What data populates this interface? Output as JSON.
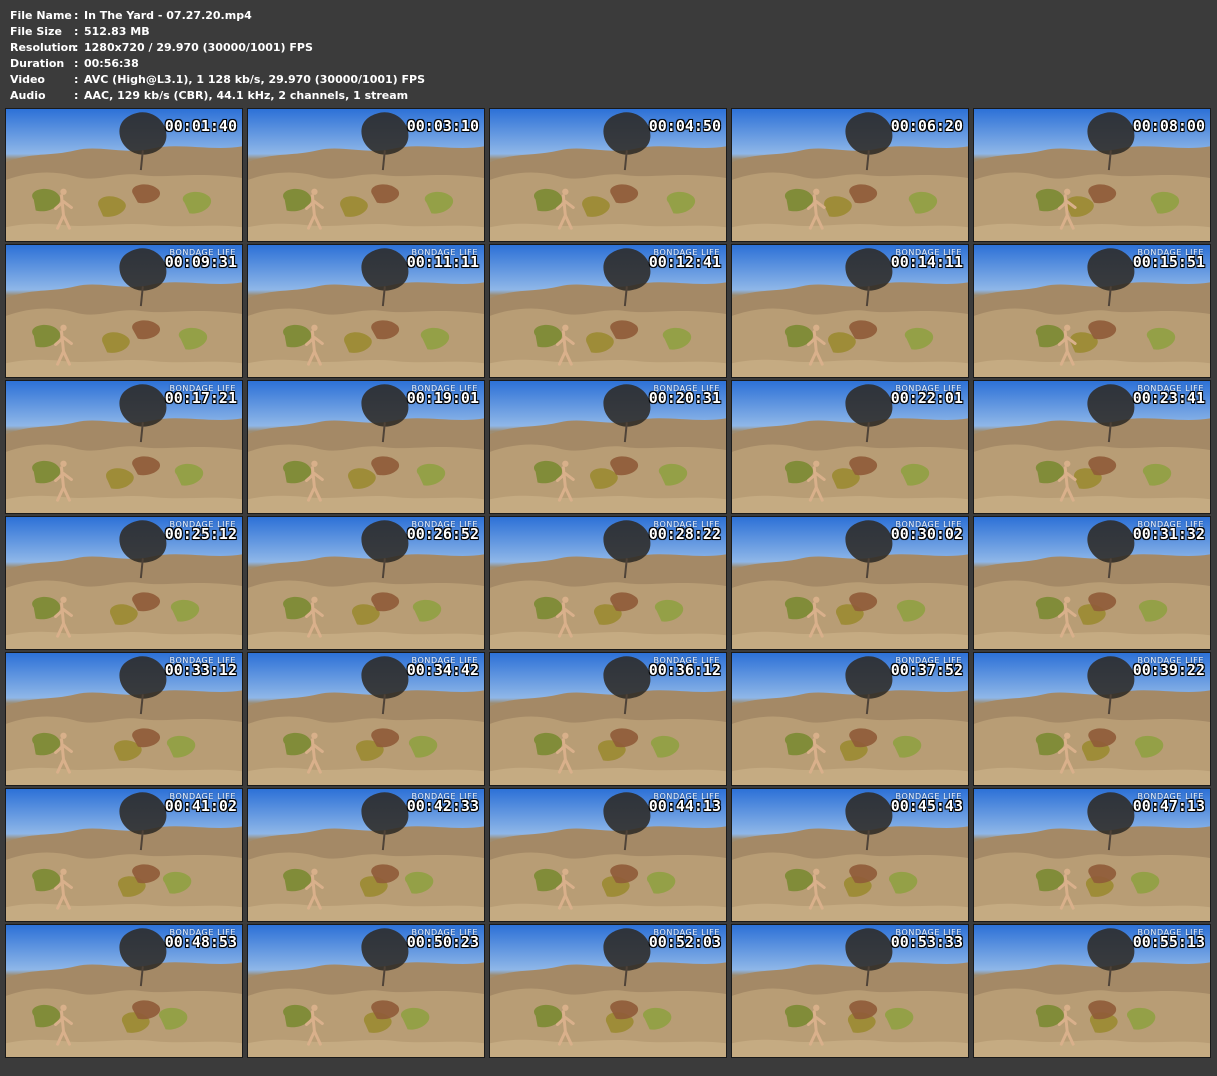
{
  "metadata": {
    "fields": [
      {
        "label": "File Name",
        "separator": ":",
        "value": "In The Yard - 07.27.20.mp4"
      },
      {
        "label": "File Size",
        "separator": ":",
        "value": "512.83 MB"
      },
      {
        "label": "Resolution",
        "separator": ":",
        "value": "1280x720 / 29.970 (30000/1001) FPS"
      },
      {
        "label": "Duration",
        "separator": ":",
        "value": "00:56:38"
      },
      {
        "label": "Video",
        "separator": ":",
        "value": "AVC (High@L3.1), 1 128 kb/s, 29.970 (30000/1001) FPS"
      },
      {
        "label": "Audio",
        "separator": ":",
        "value": "AAC, 129 kb/s (CBR), 44.1 kHz, 2 channels, 1 stream"
      }
    ]
  },
  "thumbnails": [
    {
      "time": "00:01:40",
      "watermark": ""
    },
    {
      "time": "00:03:10",
      "watermark": ""
    },
    {
      "time": "00:04:50",
      "watermark": ""
    },
    {
      "time": "00:06:20",
      "watermark": ""
    },
    {
      "time": "00:08:00",
      "watermark": ""
    },
    {
      "time": "00:09:31",
      "watermark": "BONDAGE LIFE"
    },
    {
      "time": "00:11:11",
      "watermark": "BONDAGE LIFE"
    },
    {
      "time": "00:12:41",
      "watermark": "BONDAGE LIFE"
    },
    {
      "time": "00:14:11",
      "watermark": "BONDAGE LIFE"
    },
    {
      "time": "00:15:51",
      "watermark": "BONDAGE LIFE"
    },
    {
      "time": "00:17:21",
      "watermark": "BONDAGE LIFE"
    },
    {
      "time": "00:19:01",
      "watermark": "BONDAGE LIFE"
    },
    {
      "time": "00:20:31",
      "watermark": "BONDAGE LIFE"
    },
    {
      "time": "00:22:01",
      "watermark": "BONDAGE LIFE"
    },
    {
      "time": "00:23:41",
      "watermark": "BONDAGE LIFE"
    },
    {
      "time": "00:25:12",
      "watermark": "BONDAGE LIFE"
    },
    {
      "time": "00:26:52",
      "watermark": "BONDAGE LIFE"
    },
    {
      "time": "00:28:22",
      "watermark": "BONDAGE LIFE"
    },
    {
      "time": "00:30:02",
      "watermark": "BONDAGE LIFE"
    },
    {
      "time": "00:31:32",
      "watermark": "BONDAGE LIFE"
    },
    {
      "time": "00:33:12",
      "watermark": "BONDAGE LIFE"
    },
    {
      "time": "00:34:42",
      "watermark": "BONDAGE LIFE"
    },
    {
      "time": "00:36:12",
      "watermark": "BONDAGE LIFE"
    },
    {
      "time": "00:37:52",
      "watermark": "BONDAGE LIFE"
    },
    {
      "time": "00:39:22",
      "watermark": "BONDAGE LIFE"
    },
    {
      "time": "00:41:02",
      "watermark": "BONDAGE LIFE"
    },
    {
      "time": "00:42:33",
      "watermark": "BONDAGE LIFE"
    },
    {
      "time": "00:44:13",
      "watermark": "BONDAGE LIFE"
    },
    {
      "time": "00:45:43",
      "watermark": "BONDAGE LIFE"
    },
    {
      "time": "00:47:13",
      "watermark": "BONDAGE LIFE"
    },
    {
      "time": "00:48:53",
      "watermark": "BONDAGE LIFE"
    },
    {
      "time": "00:50:23",
      "watermark": "BONDAGE LIFE"
    },
    {
      "time": "00:52:03",
      "watermark": "BONDAGE LIFE"
    },
    {
      "time": "00:53:33",
      "watermark": "BONDAGE LIFE"
    },
    {
      "time": "00:55:13",
      "watermark": "BONDAGE LIFE"
    }
  ],
  "colors": {
    "page_background": "#3b3b3b",
    "text": "#ffffff",
    "sky_top": "#2d71d7",
    "sky_bottom": "#8fb7e8",
    "dirt": "#b89a72",
    "brush_green": "#7d8b36",
    "brush_red": "#8f5b39",
    "tree_dark": "#2d2a25"
  }
}
